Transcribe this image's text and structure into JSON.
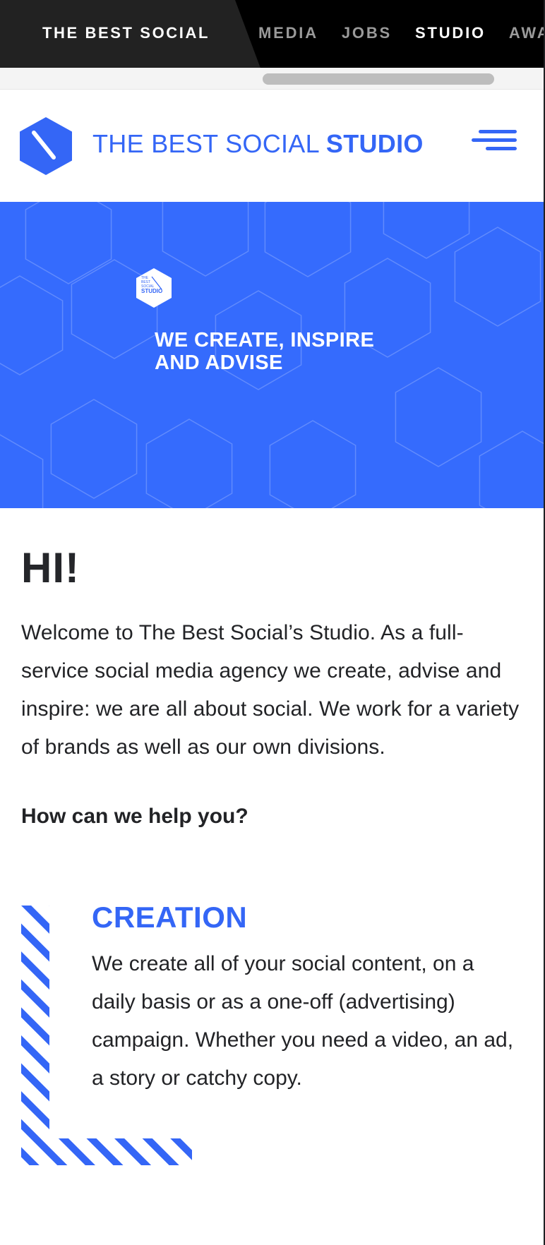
{
  "topbar": {
    "brand": "THE BEST SOCIAL",
    "nav": [
      {
        "label": "MEDIA",
        "active": false
      },
      {
        "label": "JOBS",
        "active": false
      },
      {
        "label": "STUDIO",
        "active": true
      },
      {
        "label": "AWA",
        "active": false
      }
    ]
  },
  "header": {
    "logo_icon": "hexagon-slash-icon",
    "logo_text_regular": "THE BEST SOCIAL ",
    "logo_text_bold": "STUDIO",
    "menu_icon": "hamburger-menu-icon"
  },
  "hero": {
    "badge_lines": [
      "THE",
      "BEST",
      "SOCIAL",
      "STUDIO"
    ],
    "title_line1": "WE CREATE, INSPIRE",
    "title_line2": "AND ADVISE"
  },
  "content": {
    "greeting": "HI!",
    "intro": "Welcome to The Best Social’s Studio. As a full-service social media agency we create, advise and inspire: we are all about social. We work for a variety of brands as well as our own divisions.",
    "help_heading": "How can we help you?",
    "services": [
      {
        "title": "CREATION",
        "text": "We create all of your social content, on a daily basis or as a one-off (advertising) campaign. Whether you need a video, an ad, a story or catchy copy."
      }
    ]
  },
  "colors": {
    "accent": "#3466f6",
    "hero_bg": "#356bfd",
    "topbar_bg": "#000000",
    "brand_tab_bg": "#222222",
    "text": "#222326"
  }
}
